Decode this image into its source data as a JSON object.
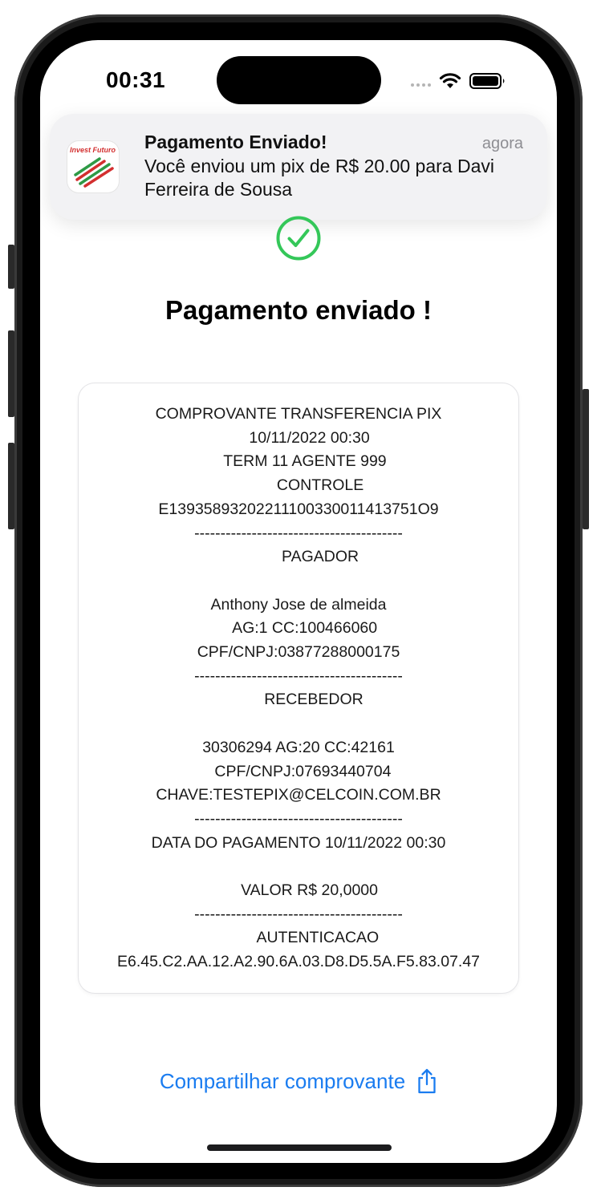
{
  "status_bar": {
    "time": "00:31"
  },
  "notification": {
    "app_icon_text": "Invest Futuro",
    "title": "Pagamento Enviado!",
    "time": "agora",
    "body": "Você enviou um pix de R$ 20.00 para Davi Ferreira de Sousa"
  },
  "page": {
    "title": "Pagamento enviado !"
  },
  "receipt": {
    "text": "COMPROVANTE TRANSFERENCIA PIX\n     10/11/2022 00:30\n   TERM 11 AGENTE 999\n          CONTROLE\nE13935893202211100330011413751O9\n----------------------------------------\n          PAGADOR\n\nAnthony Jose de almeida\n   AG:1 CC:100466060\nCPF/CNPJ:03877288000175\n----------------------------------------\n       RECEBEDOR\n\n30306294 AG:20 CC:42161\n  CPF/CNPJ:07693440704\nCHAVE:TESTEPIX@CELCOIN.COM.BR\n----------------------------------------\nDATA DO PAGAMENTO 10/11/2022 00:30\n\n     VALOR R$ 20,0000\n----------------------------------------\n         AUTENTICACAO\nE6.45.C2.AA.12.A2.90.6A.03.D8.D5.5A.F5.83.07.47"
  },
  "share": {
    "label": "Compartilhar comprovante",
    "icon": "share-icon"
  },
  "colors": {
    "accent": "#1a7cf0",
    "success": "#34c759",
    "notification_bg": "#f2f2f4"
  }
}
